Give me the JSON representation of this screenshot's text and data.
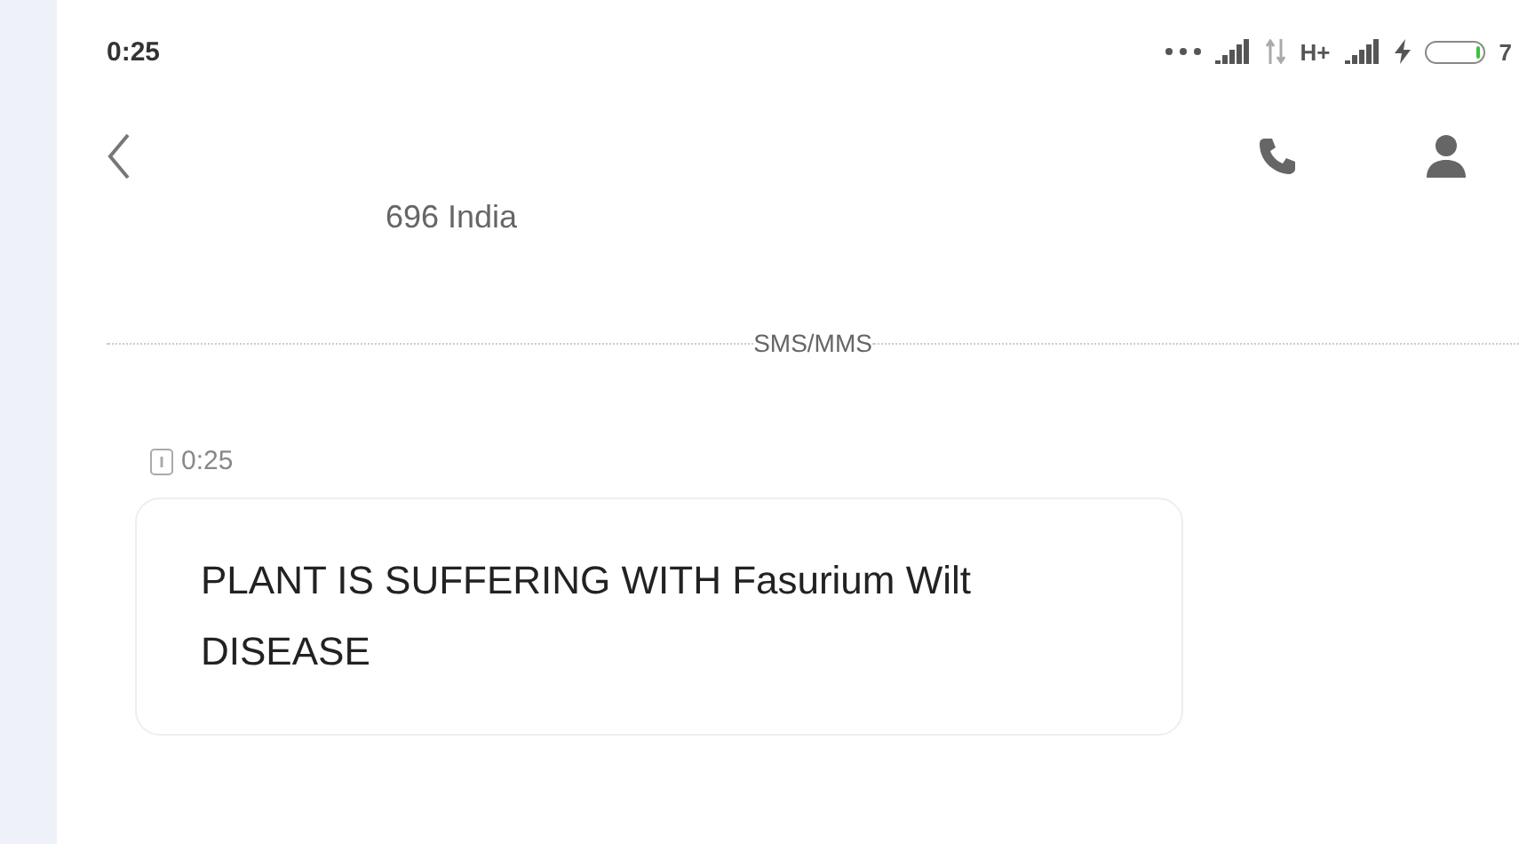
{
  "status_bar": {
    "time": "0:25",
    "network": "H+",
    "battery": {
      "level": 0.07,
      "charging": true,
      "reading": "7"
    }
  },
  "header": {
    "contact": "696 India"
  },
  "divider_label": "SMS/MMS",
  "messages": [
    {
      "time": "0:25",
      "text": "PLANT IS SUFFERING WITH Fasurium Wilt DISEASE"
    }
  ]
}
